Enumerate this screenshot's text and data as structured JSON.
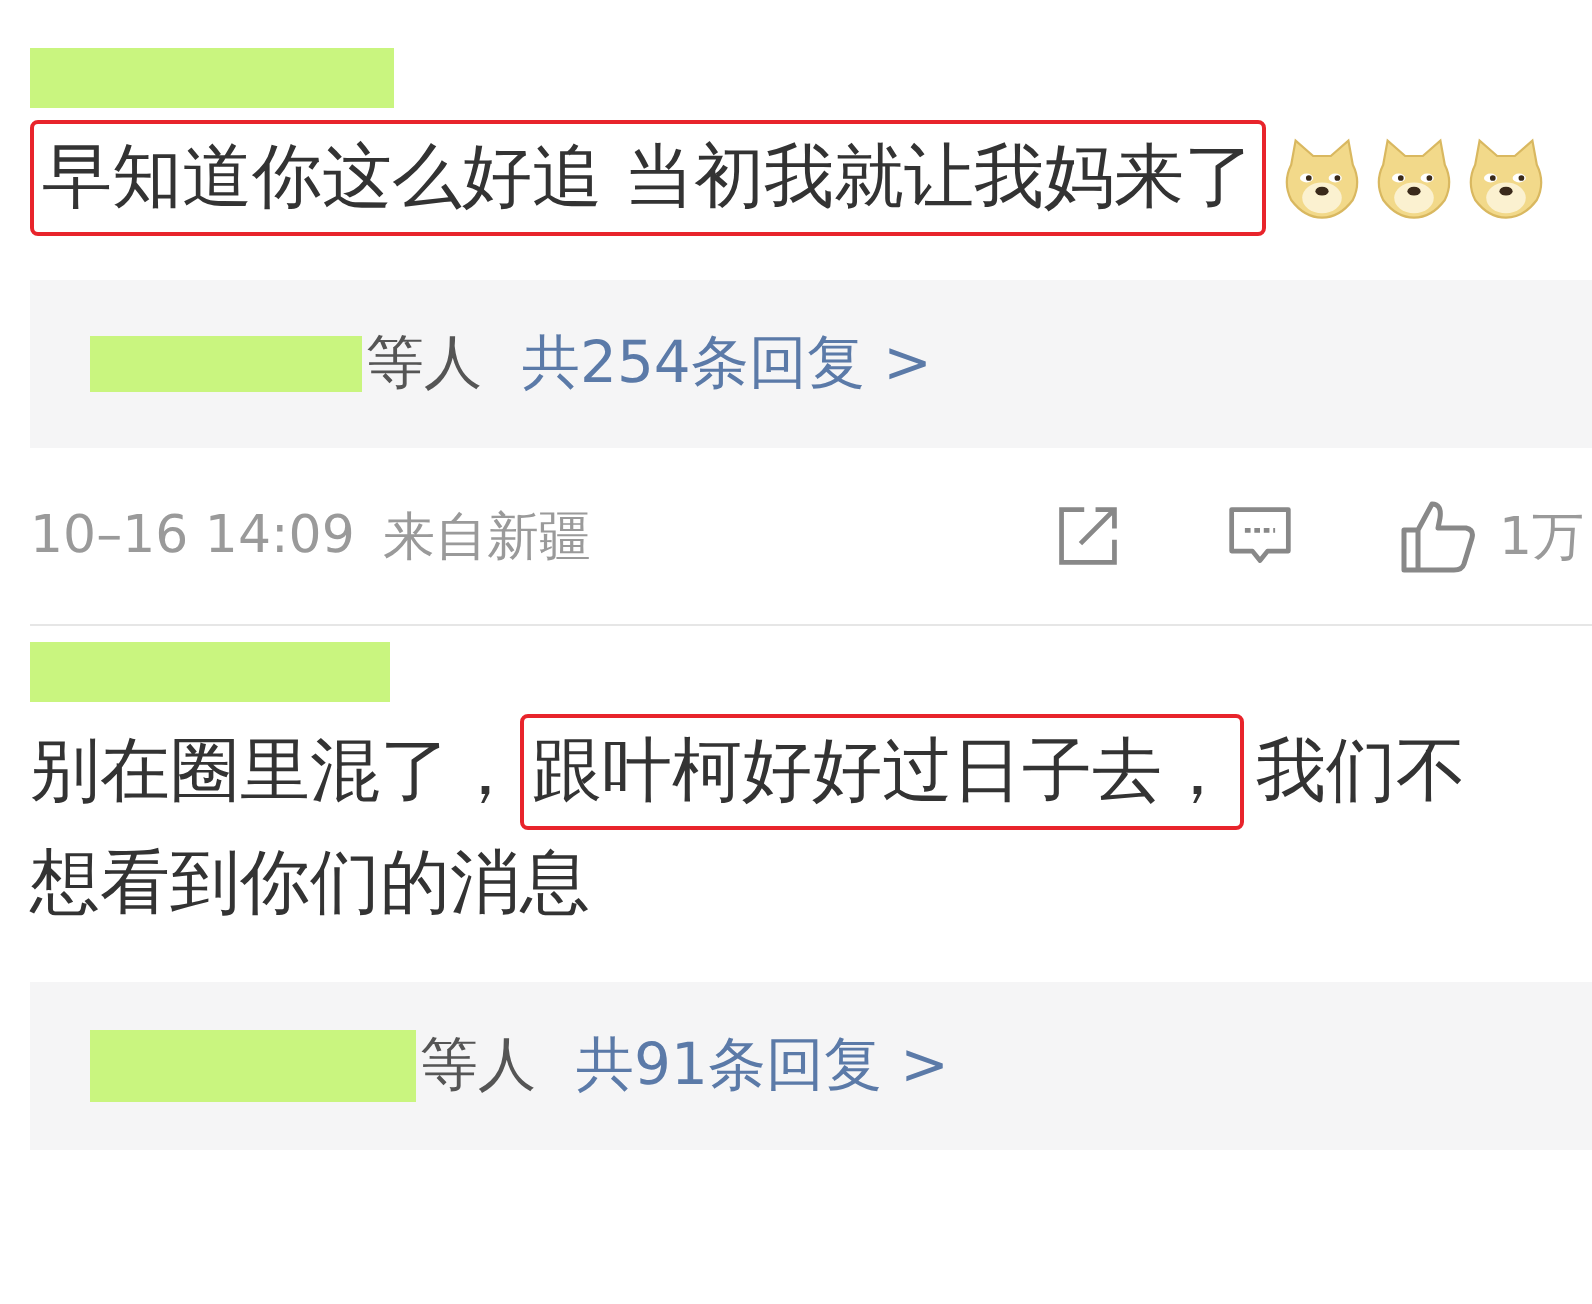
{
  "comments": [
    {
      "segments": [
        {
          "kind": "text",
          "text": "早知道你这么好追 当初我就让我妈来了",
          "highlighted": true
        },
        {
          "kind": "emoji"
        },
        {
          "kind": "emoji"
        },
        {
          "kind": "emoji"
        }
      ],
      "replies": {
        "names_suffix": "等人",
        "link": "共254条回复 >"
      },
      "meta": {
        "time": "10–16 14:09",
        "location": "来自新疆",
        "likes": "1万"
      }
    },
    {
      "segments": [
        {
          "kind": "text",
          "text": "别在圈里混了，",
          "highlighted": false
        },
        {
          "kind": "text",
          "text": "跟叶柯好好过日子去，",
          "highlighted": true
        },
        {
          "kind": "text",
          "text": "我们不",
          "highlighted": false
        },
        {
          "kind": "text",
          "text": "想看到你们的消息",
          "highlighted": false
        }
      ],
      "replies": {
        "names_suffix": "等人",
        "link": "共91条回复 >"
      }
    }
  ]
}
